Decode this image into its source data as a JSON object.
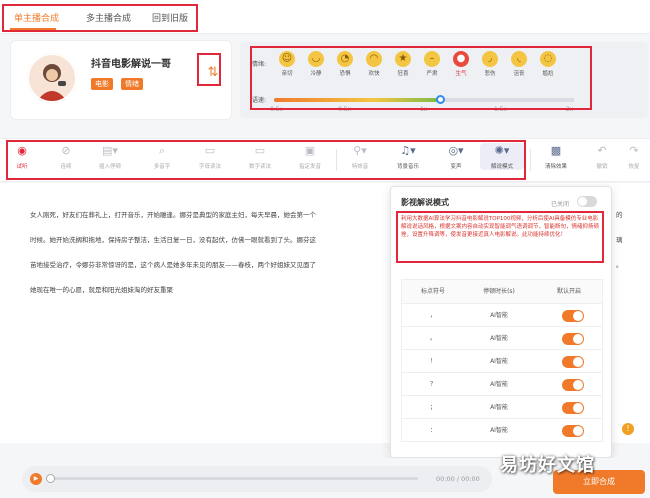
{
  "tabs": [
    {
      "label": "单主播合成"
    },
    {
      "label": "多主播合成"
    },
    {
      "label": "回到旧版"
    }
  ],
  "anchor": {
    "name": "抖音电影解说一哥",
    "badges": [
      "电影",
      "情绪"
    ],
    "swap_icon": "swap-vertical-icon"
  },
  "emotion": {
    "label": "情绪:",
    "items": [
      {
        "label": "亲切",
        "icon": "smile-face-icon",
        "active": false
      },
      {
        "label": "冷静",
        "icon": "calm-face-icon",
        "active": false
      },
      {
        "label": "恐惧",
        "icon": "fear-face-icon",
        "active": false
      },
      {
        "label": "欢快",
        "icon": "happy-face-icon",
        "active": false
      },
      {
        "label": "狂喜",
        "icon": "ecstatic-face-icon",
        "active": false
      },
      {
        "label": "严肃",
        "icon": "serious-face-icon",
        "active": false
      },
      {
        "label": "生气",
        "icon": "angry-face-icon",
        "active": true
      },
      {
        "label": "悲伤",
        "icon": "sad-face-icon",
        "active": false
      },
      {
        "label": "沮丧",
        "icon": "depressed-face-icon",
        "active": false
      },
      {
        "label": "尴尬",
        "icon": "awkward-face-icon",
        "active": false
      }
    ]
  },
  "speed": {
    "label": "语速:",
    "ticks": [
      "0.5x",
      "0.5x",
      "1x",
      "1.5x",
      "2x"
    ],
    "value": 1.0
  },
  "toolbar": {
    "items": [
      {
        "label": "试听",
        "icon": "play-circle-icon"
      },
      {
        "label": "连续",
        "icon": "link-icon"
      },
      {
        "label": "插入停顿",
        "icon": "pause-insert-icon"
      },
      {
        "label": "多音字",
        "icon": "polyphone-icon"
      },
      {
        "label": "字母读法",
        "icon": "letter-icon"
      },
      {
        "label": "数字读法",
        "icon": "number-icon"
      },
      {
        "label": "指定发音",
        "icon": "pronounce-icon"
      },
      {
        "label": "特效音",
        "icon": "sound-effect-icon"
      },
      {
        "label": "背景音乐",
        "icon": "music-icon"
      },
      {
        "label": "变声",
        "icon": "voice-change-icon"
      },
      {
        "label": "解说模式",
        "icon": "narration-mode-icon"
      },
      {
        "label": "清除效果",
        "icon": "clear-effect-icon"
      },
      {
        "label": "撤销",
        "icon": "undo-icon"
      },
      {
        "label": "恢复",
        "icon": "redo-icon"
      }
    ]
  },
  "editor": {
    "lines": [
      "女人刚死，好友们在葬礼上，打开音乐，开始雕逢。娜芬是典型的家庭主妇，每天早晨，她会第一个",
      "时候。她开始洗搁和拖地，保持房子整洁，生活日复一日，没有起伏，仿佛一眼就看到了头。娜芬这",
      "苗地接受治疗，令娜芬非常惊讶的是，这个病人是她多年未见的朋友——春枝，两个好姐妹又见面了",
      "她现在唯一的心愿，就是和阳光姐妹淘的好友重聚"
    ],
    "right_fragments": [
      "的",
      "璃",
      "。"
    ]
  },
  "popup": {
    "title": "影视解说模式",
    "status": "已关闭",
    "description": "利用大数据AI算法学习抖音电影解说TOP100视频，分析后使AI具备模仿专业电影解说说话风格，根据文案内容自动实现智能调气语调调节，智能断句，情绪抑扬顿挫，设置升降调等，使发音更接近真人电影解说。此功能持续优化！",
    "headers": [
      "标点符号",
      "停顿时长(s)",
      "默认开启"
    ],
    "rows": [
      {
        "symbol": "，",
        "pause": "AI智能",
        "on": true
      },
      {
        "symbol": "。",
        "pause": "AI智能",
        "on": true
      },
      {
        "symbol": "！",
        "pause": "AI智能",
        "on": true
      },
      {
        "symbol": "？",
        "pause": "AI智能",
        "on": true
      },
      {
        "symbol": "；",
        "pause": "AI智能",
        "on": true
      },
      {
        "symbol": "：",
        "pause": "AI智能",
        "on": true
      }
    ]
  },
  "player": {
    "time": "00:00 / 00:00"
  },
  "submit_label": "立即合成",
  "watermark": "易坊好文馆",
  "colors": {
    "accent": "#f07a2a",
    "highlight_box": "#e0283a"
  }
}
